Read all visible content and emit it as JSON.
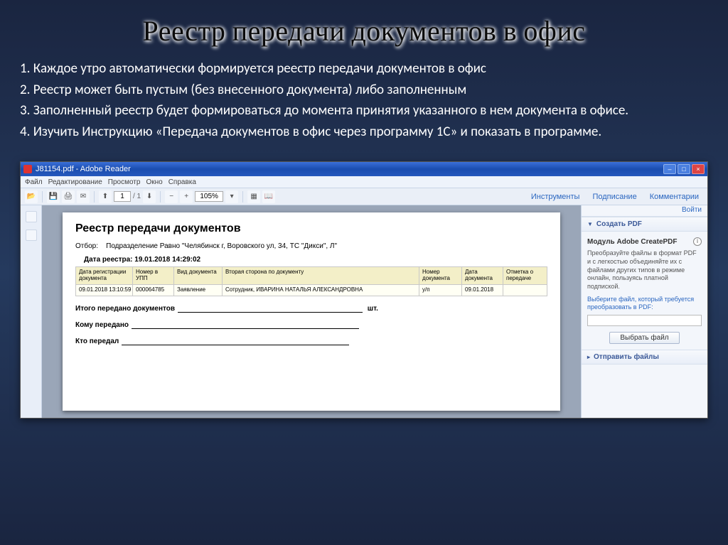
{
  "slide": {
    "title": "Реестр передачи документов в офис",
    "paragraphs": [
      "1. Каждое утро автоматически формируется реестр передачи документов  в офис",
      "2. Реестр может быть  пустым (без  внесенного документа)  либо заполненным",
      "3. Заполненный реестр будет формироваться до момента принятия указанного в нем документа в офисе.",
      "4.  Изучить  Инструкцию  «Передача  документов  в  офис  через  программу  1С»  и показать в программе."
    ]
  },
  "reader": {
    "window_title": "J81154.pdf - Adobe Reader",
    "menu": [
      "Файл",
      "Редактирование",
      "Просмотр",
      "Окно",
      "Справка"
    ],
    "page_current": "1",
    "page_total": "/ 1",
    "zoom": "105%",
    "tabs": {
      "tools": "Инструменты",
      "sign": "Подписание",
      "comment": "Комментарии"
    }
  },
  "document": {
    "heading": "Реестр передачи документов",
    "filter_label": "Отбор:",
    "filter_value": "Подразделение Равно \"Челябинск г, Воровского ул, 34, ТС \"Дикси\", Л\"",
    "date_label": "Дата реестра: 19.01.2018 14:29:02",
    "columns": [
      "Дата регистрации документа",
      "Номер в УПП",
      "Вид документа",
      "Вторая сторона по документу",
      "Номер документа",
      "Дата документа",
      "Отметка о передаче"
    ],
    "row": [
      "09.01.2018 13:10:59",
      "000064785",
      "Заявление",
      "Сотрудник, ИВАРИНА НАТАЛЬЯ АЛЕКСАНДРОВНА",
      "у/п",
      "09.01.2018",
      ""
    ],
    "total_line": "Итого передано документов",
    "total_suffix": "шт.",
    "to_whom": "Кому передано",
    "from_whom": "Кто передал"
  },
  "sidebar": {
    "login": "Войти",
    "create_pdf": "Создать PDF",
    "module_title": "Модуль Adobe CreatePDF",
    "module_desc": "Преобразуйте файлы в формат PDF и с легкостью объединяйте их с файлами других типов в режиме онлайн, пользуясь платной подпиской.",
    "select_hint": "Выберите файл, который требуется преобразовать в PDF:",
    "select_button": "Выбрать файл",
    "send_files": "Отправить файлы"
  }
}
